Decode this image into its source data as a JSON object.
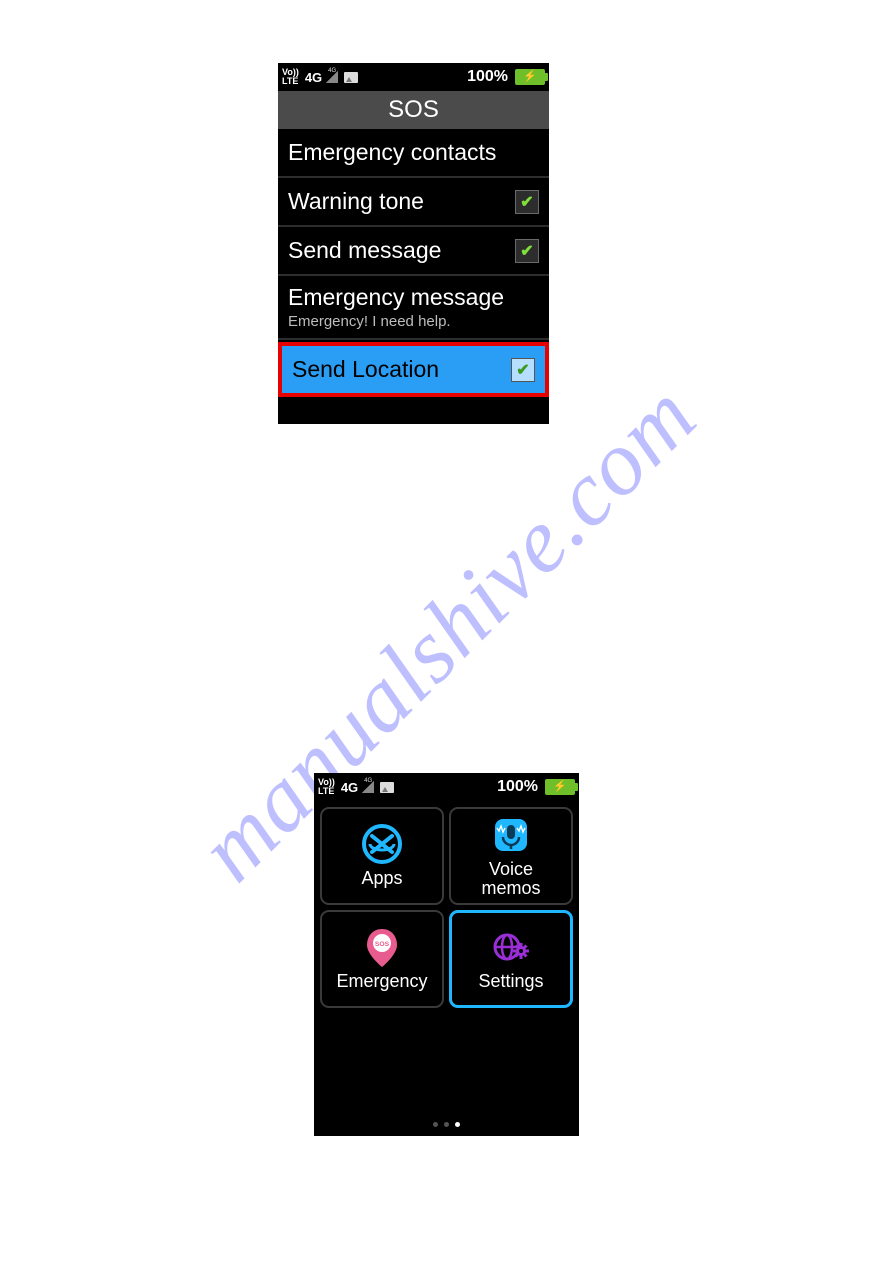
{
  "watermark": "manualshive.com",
  "status": {
    "volte_top": "Vo))",
    "volte_bottom": "LTE",
    "net": "4G",
    "battery_pct": "100%"
  },
  "phone1": {
    "title": "SOS",
    "items": {
      "emergency_contacts": "Emergency contacts",
      "warning_tone": "Warning tone",
      "send_message": "Send message",
      "emergency_message": "Emergency message",
      "emergency_message_sub": "Emergency! I need help.",
      "send_location": "Send Location"
    }
  },
  "phone2": {
    "apps": {
      "apps": "Apps",
      "voice_memos": "Voice\nmemos",
      "emergency": "Emergency",
      "settings": "Settings"
    }
  }
}
